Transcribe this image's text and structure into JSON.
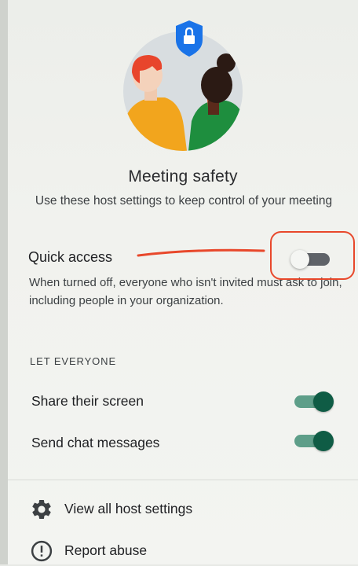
{
  "header": {
    "title": "Meeting safety",
    "subtitle": "Use these host settings to keep control of your meeting"
  },
  "quick_access": {
    "label": "Quick access",
    "description": "When turned off, everyone who isn't invited must ask to join, including people in your organization.",
    "enabled": false
  },
  "let_everyone": {
    "header": "LET EVERYONE",
    "items": [
      {
        "label": "Share their screen",
        "enabled": true
      },
      {
        "label": "Send chat messages",
        "enabled": true
      }
    ]
  },
  "footer": {
    "items": [
      {
        "label": "View all host settings",
        "icon": "gear-icon"
      },
      {
        "label": "Report abuse",
        "icon": "exclamation-circle-icon"
      }
    ]
  },
  "colors": {
    "toggle_on_thumb": "#0f5c45",
    "toggle_on_track": "#5e9e89",
    "toggle_off_track": "#5f6368",
    "annotation_red": "#e8482b",
    "shield_blue": "#1a73e8"
  }
}
